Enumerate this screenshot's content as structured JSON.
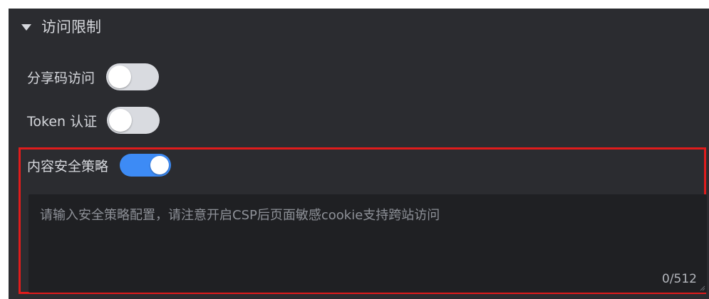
{
  "section": {
    "title": "访问限制",
    "expanded": true,
    "caret_icon": "caret-down-icon"
  },
  "settings": {
    "share_code": {
      "label": "分享码访问",
      "enabled": false
    },
    "token_auth": {
      "label": "Token 认证",
      "enabled": false
    },
    "csp": {
      "label": "内容安全策略",
      "enabled": true,
      "textarea": {
        "value": "",
        "placeholder": "请输入安全策略配置，请注意开启CSP后页面敏感cookie支持跨站访问",
        "counter": "0/512"
      }
    }
  },
  "colors": {
    "panel_bg": "#2b2c30",
    "text": "#d6d8dd",
    "toggle_on": "#3d8bf5",
    "toggle_off": "#d9dbe0",
    "highlight_border": "#e01c1c"
  }
}
